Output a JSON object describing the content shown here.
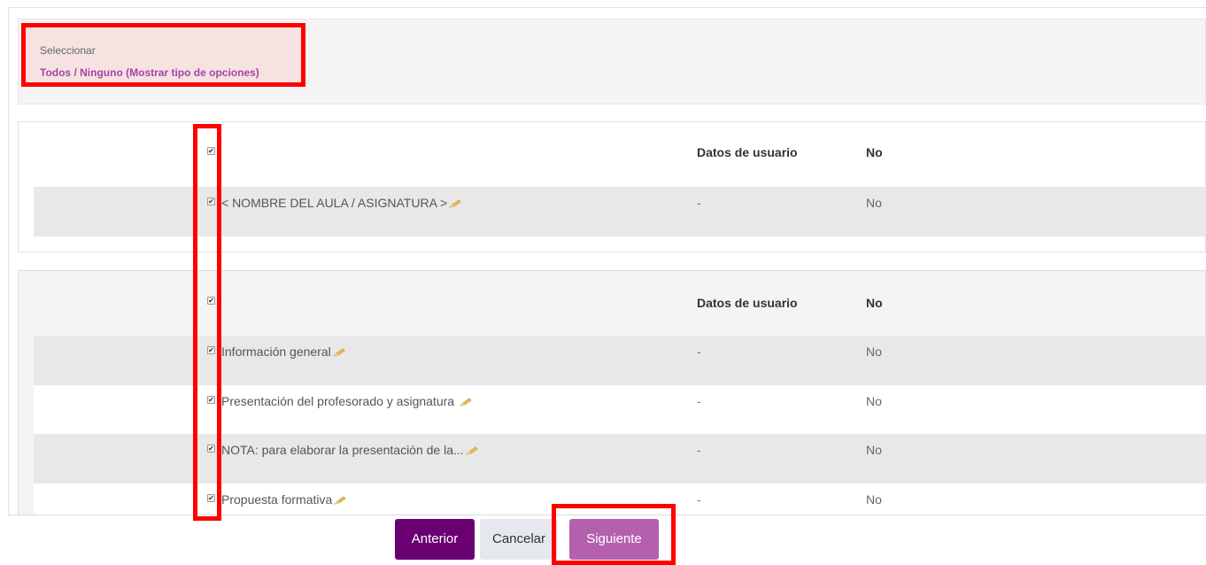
{
  "selection": {
    "label": "Seleccionar",
    "all": "Todos",
    "separator": " / ",
    "none": "Ninguno",
    "show_types": "(Mostrar tipo de opciones)"
  },
  "section_1": {
    "header": {
      "type": "Datos de usuario",
      "included": "No"
    },
    "rows": [
      {
        "name": "< NOMBRE DEL AULA / ASIGNATURA >",
        "type": "-",
        "included": "No"
      }
    ]
  },
  "section_2": {
    "header": {
      "type": "Datos de usuario",
      "included": "No"
    },
    "rows": [
      {
        "name": "Información general",
        "type": "-",
        "included": "No"
      },
      {
        "name": "Presentación del profesorado y asignatura ",
        "type": "-",
        "included": "No"
      },
      {
        "name": "NOTA:  para elaborar la presentación de la...",
        "type": "-",
        "included": "No"
      },
      {
        "name": "Propuesta formativa",
        "type": "-",
        "included": "No"
      }
    ]
  },
  "buttons": {
    "previous": "Anterior",
    "cancel": "Cancelar",
    "next": "Siguiente"
  },
  "colors": {
    "accent": "#a544a5",
    "primary_button": "#6a0072",
    "next_button": "#b460ae",
    "highlight": "#ff0000"
  },
  "icons": {
    "checkbox": "checkbox-checked-icon",
    "edit": "pencil-edit-icon"
  }
}
